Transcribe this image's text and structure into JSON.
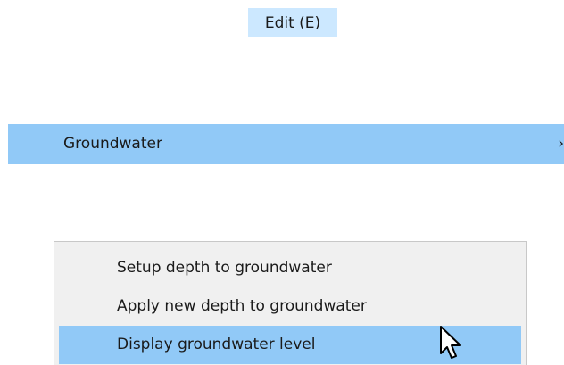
{
  "menubar": {
    "edit_label": "Edit (E)"
  },
  "submenu": {
    "label": "Groundwater",
    "chevron": "›"
  },
  "popup": {
    "items": [
      {
        "label": "Setup depth to groundwater"
      },
      {
        "label": "Apply new depth to groundwater"
      },
      {
        "label": "Display groundwater level",
        "selected": true
      }
    ]
  },
  "cursor": {
    "icon": "mouse-pointer-icon"
  },
  "colors": {
    "menubar_highlight": "#cce8ff",
    "selection": "#91c9f7",
    "popup_background": "#f0f0f0"
  }
}
